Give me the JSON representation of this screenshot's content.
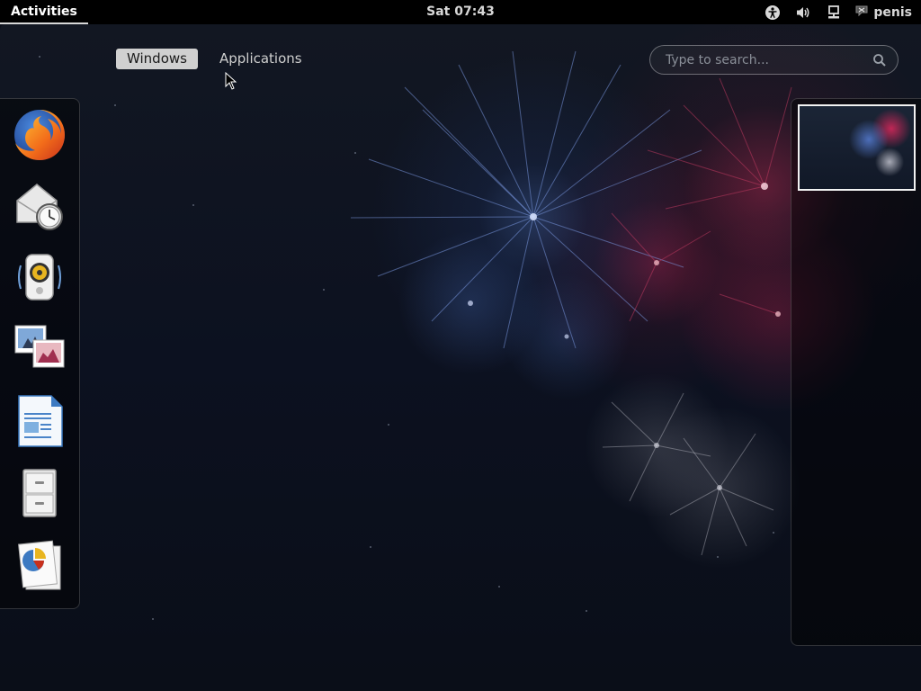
{
  "top_panel": {
    "activities_label": "Activities",
    "clock": "Sat 07:43",
    "status_icons": [
      "accessibility-icon",
      "volume-icon",
      "network-icon"
    ],
    "user_name": "penis"
  },
  "overview": {
    "tabs": [
      {
        "label": "Windows",
        "active": true
      },
      {
        "label": "Applications",
        "active": false
      }
    ],
    "search": {
      "placeholder": "Type to search..."
    }
  },
  "dash": {
    "favorites": [
      {
        "name": "firefox-icon"
      },
      {
        "name": "evolution-mail-icon"
      },
      {
        "name": "rhythmbox-icon"
      },
      {
        "name": "shotwell-icon"
      },
      {
        "name": "libreoffice-writer-icon"
      },
      {
        "name": "files-icon"
      },
      {
        "name": "document-viewer-icon"
      }
    ]
  },
  "workspaces": {
    "count": 1
  },
  "colors": {
    "panel_bg": "#000000",
    "active_tab_bg": "#d0d0d0",
    "desktop_bg": "#0c1120"
  }
}
